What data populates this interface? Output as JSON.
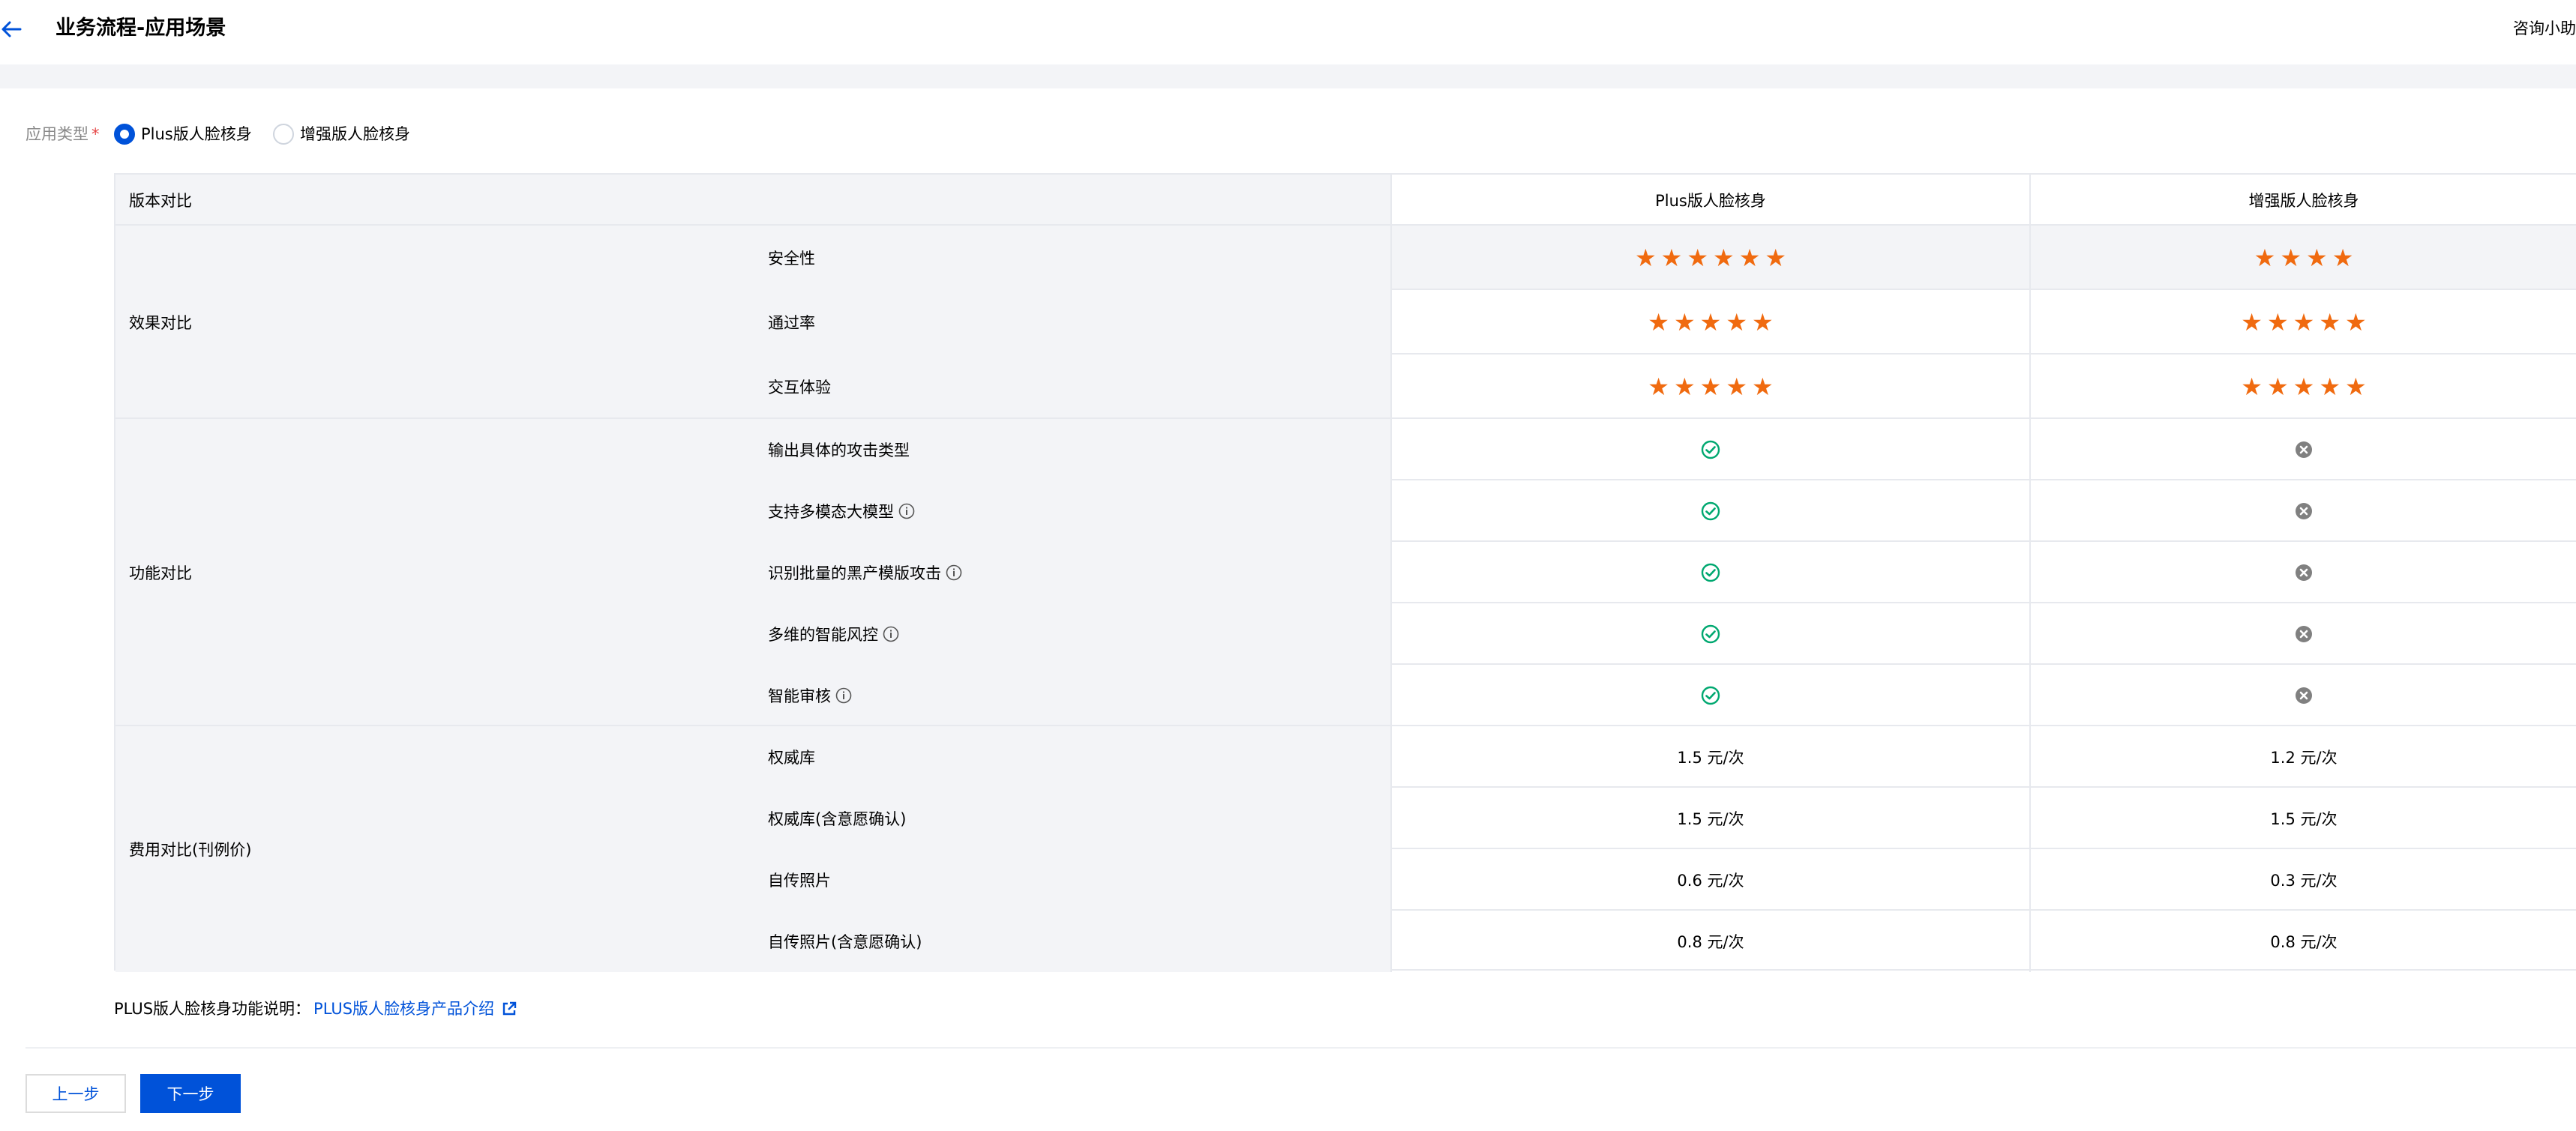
{
  "header": {
    "title": "业务流程-应用场景",
    "consult": "咨询小助"
  },
  "form": {
    "label": "应用类型",
    "required_mark": "*",
    "options": [
      {
        "label": "Plus版人脸核身",
        "selected": true
      },
      {
        "label": "增强版人脸核身",
        "selected": false
      }
    ]
  },
  "table": {
    "header": {
      "label": "版本对比",
      "plus": "Plus版人脸核身",
      "enhanced": "增强版人脸核身"
    },
    "groups": [
      {
        "label": "效果对比",
        "rows": [
          {
            "label": "安全性",
            "plus_stars": 6,
            "enhanced_stars": 4
          },
          {
            "label": "通过率",
            "plus_stars": 5,
            "enhanced_stars": 5
          },
          {
            "label": "交互体验",
            "plus_stars": 5,
            "enhanced_stars": 5
          }
        ]
      },
      {
        "label": "功能对比",
        "rows": [
          {
            "label": "输出具体的攻击类型",
            "info": false,
            "plus": "check-icon",
            "enhanced": "cross-icon"
          },
          {
            "label": "支持多模态大模型",
            "info": true,
            "plus": "check-icon",
            "enhanced": "cross-icon"
          },
          {
            "label": "识别批量的黑产模版攻击",
            "info": true,
            "plus": "check-icon",
            "enhanced": "cross-icon"
          },
          {
            "label": "多维的智能风控",
            "info": true,
            "plus": "check-icon",
            "enhanced": "cross-icon"
          },
          {
            "label": "智能审核",
            "info": true,
            "plus": "check-icon",
            "enhanced": "cross-icon"
          }
        ]
      },
      {
        "label": "费用对比(刊例价)",
        "rows": [
          {
            "label": "权威库",
            "plus": "1.5 元/次",
            "enhanced": "1.2 元/次"
          },
          {
            "label": "权威库(含意愿确认)",
            "plus": "1.5 元/次",
            "enhanced": "1.5 元/次"
          },
          {
            "label": "自传照片",
            "plus": "0.6 元/次",
            "enhanced": "0.3 元/次"
          },
          {
            "label": "自传照片(含意愿确认)",
            "plus": "0.8 元/次",
            "enhanced": "0.8 元/次"
          }
        ]
      }
    ]
  },
  "note": {
    "text": "PLUS版人脸核身功能说明：",
    "link": "PLUS版人脸核身产品介绍"
  },
  "buttons": {
    "prev": "上一步",
    "next": "下一步"
  },
  "colors": {
    "primary": "#0052d9",
    "star": "#f06a0f",
    "check": "#00a870",
    "cross": "#808080"
  }
}
